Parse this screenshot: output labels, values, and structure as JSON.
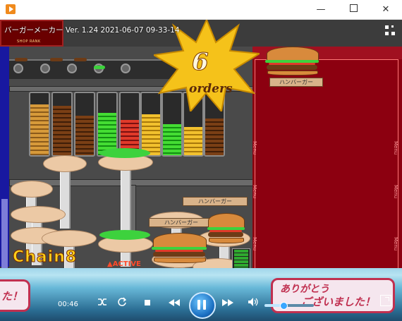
{
  "window": {
    "minimize_glyph": "—",
    "close_glyph": "✕"
  },
  "overlay": {
    "title": "バーガーメーカー Ver. 1.24 2021-06-07 09-33-14",
    "shop_rank_label": "SHOP RANK"
  },
  "game": {
    "orders_count": "6",
    "orders_label": "orders",
    "chain_text": "Chain8",
    "active_text": "▲ACTIVE",
    "plate_tags": [
      "ハンバーガー",
      "ハンバーガー",
      "ハンバーガー"
    ],
    "menu_labels": [
      "Menu",
      "Menu",
      "Menu",
      "Menu",
      "Menu",
      "Menu"
    ]
  },
  "banners": {
    "left_text": "た！",
    "right_line1": "ありがとう",
    "right_line2": "ございました！"
  },
  "player": {
    "time": "00:46",
    "volume_level": 0.38,
    "icons": [
      "shuffle-icon",
      "repeat-icon",
      "stop-icon",
      "previous-icon",
      "pause-icon",
      "next-icon",
      "volume-icon",
      "switch-to-library-icon",
      "fullscreen-icon"
    ]
  },
  "colors": {
    "order_panel": "#8c0010",
    "play_button": "#1a6fc2",
    "chain_text": "#ffd21a"
  }
}
